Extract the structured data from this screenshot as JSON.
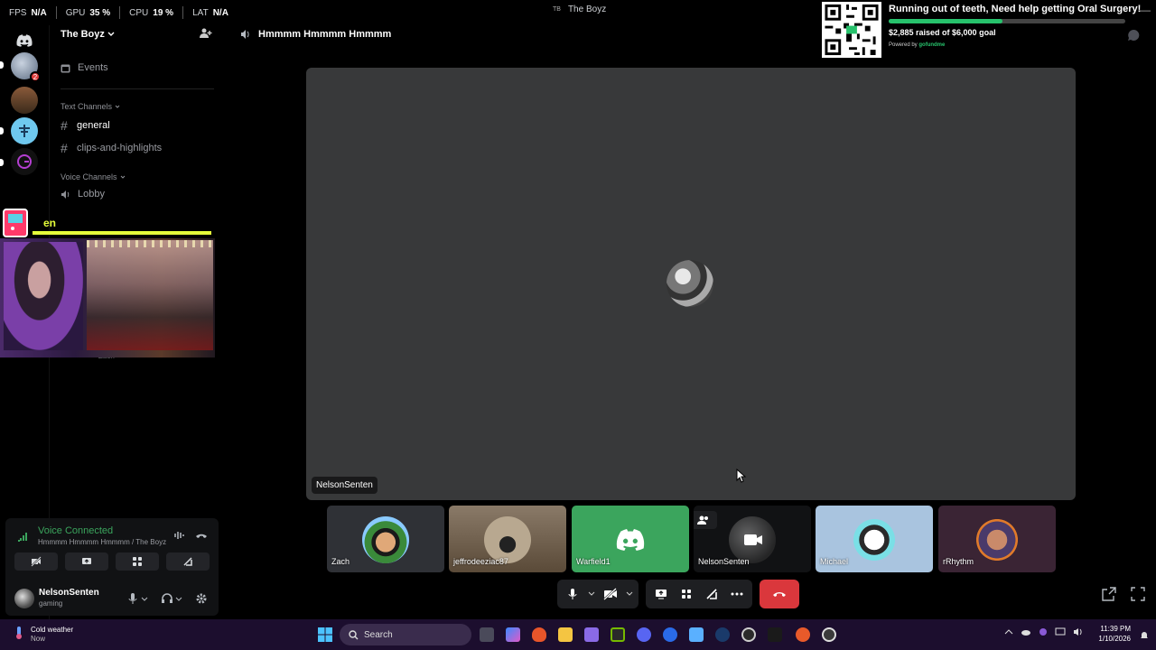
{
  "stats": [
    {
      "label": "FPS",
      "value": "N/A"
    },
    {
      "label": "GPU",
      "value": "35 %"
    },
    {
      "label": "CPU",
      "value": "19 %"
    },
    {
      "label": "LAT",
      "value": "N/A"
    }
  ],
  "window": {
    "badge": "TB",
    "title": "The Boyz"
  },
  "rail": {
    "unread_badge": "2"
  },
  "sidebar": {
    "server_name": "The Boyz",
    "events_label": "Events",
    "text_category": "Text Channels",
    "text_channels": [
      "general",
      "clips-and-highlights"
    ],
    "voice_category": "Voice Channels",
    "voice_channels": [
      "Lobby"
    ],
    "voice_member": "Zach"
  },
  "webcam": {
    "overlay_text": "en"
  },
  "voice": {
    "status": "Voice Connected",
    "location": "Hmmmm Hmmmm Hmmmm / The Boyz"
  },
  "user": {
    "name": "NelsonSenten",
    "status": "gaming"
  },
  "main": {
    "channel_name": "Hmmmm Hmmmm Hmmmm",
    "stage_label": "NelsonSenten"
  },
  "goal": {
    "title": "Running out of teeth, Need help getting Oral Surgery!",
    "raised": "$2,885 raised of $6,000 goal",
    "progress": 0.48,
    "powered_by": "Powered by",
    "brand": "gofundme"
  },
  "participants": [
    {
      "name": "Zach",
      "bg": "#2f3136"
    },
    {
      "name": "jeffrodeeziac87",
      "bg": "#7a6a58"
    },
    {
      "name": "Warfield1",
      "bg": "#3ba55d"
    },
    {
      "name": "NelsonSenten",
      "bg": "#111214"
    },
    {
      "name": "Michael",
      "bg": "#a9c4df"
    },
    {
      "name": "rRhythm",
      "bg": "#3a2434"
    }
  ],
  "taskbar": {
    "weather_title": "Cold weather",
    "weather_sub": "Now",
    "search_placeholder": "Search",
    "time": "11:39 PM",
    "date": "1/10/2026"
  },
  "colors": {
    "accent_green": "#3ba55d",
    "hangup_red": "#da373c",
    "goal_green": "#27c26c"
  }
}
